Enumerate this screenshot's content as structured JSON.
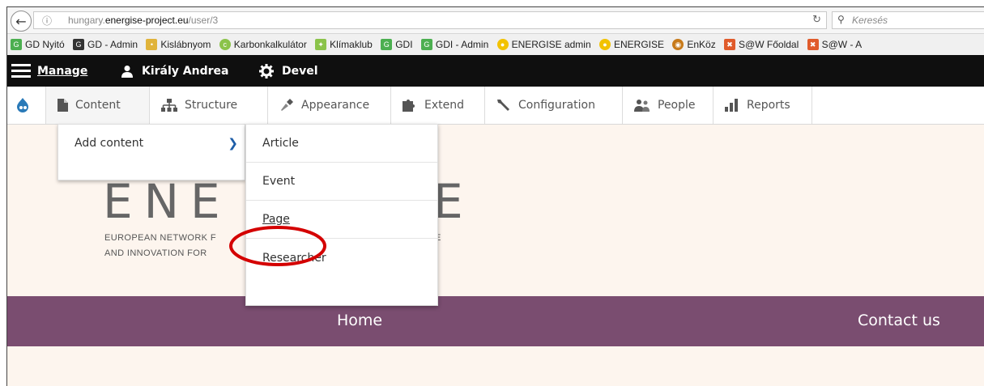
{
  "browser": {
    "url_prefix": "hungary.",
    "url_domain": "energise-project.eu",
    "url_path": "/user/3",
    "search_placeholder": "Keresés"
  },
  "bookmarks": [
    {
      "label": "GD Nyitó",
      "icon": "gd-icon",
      "color": "#4caf50"
    },
    {
      "label": "GD - Admin",
      "icon": "gd-admin-icon",
      "color": "#333333"
    },
    {
      "label": "Kislábnyom",
      "icon": "footprint-icon",
      "color": "#e0b33a"
    },
    {
      "label": "Karbonkalkulátor",
      "icon": "co2-icon",
      "color": "#8bc34a"
    },
    {
      "label": "Klímaklub",
      "icon": "leaf-icon",
      "color": "#8bc34a"
    },
    {
      "label": "GDI",
      "icon": "gdi-icon",
      "color": "#4caf50"
    },
    {
      "label": "GDI - Admin",
      "icon": "gdi-admin-icon",
      "color": "#4caf50"
    },
    {
      "label": "ENERGISE admin",
      "icon": "bulb-icon",
      "color": "#f2c200"
    },
    {
      "label": "ENERGISE",
      "icon": "bulb-icon",
      "color": "#f2c200"
    },
    {
      "label": "EnKöz",
      "icon": "enkoz-icon",
      "color": "#c77a1a"
    },
    {
      "label": "S@W Főoldal",
      "icon": "saw-icon",
      "color": "#e05b2b"
    },
    {
      "label": "S@W - A",
      "icon": "saw-icon",
      "color": "#e05b2b"
    }
  ],
  "toolbar": {
    "manage": "Manage",
    "user": "Király Andrea",
    "devel": "Devel"
  },
  "tray": {
    "content": "Content",
    "structure": "Structure",
    "appearance": "Appearance",
    "extend": "Extend",
    "configuration": "Configuration",
    "people": "People",
    "reports": "Reports"
  },
  "content_menu": {
    "add_content": "Add content"
  },
  "add_content_menu": [
    "Article",
    "Event",
    "Page",
    "Researcher"
  ],
  "site": {
    "logo_text": "ENE",
    "logo_tail": "E",
    "tagline1": "EUROPEAN NETWORK F",
    "tagline1_tail": "E",
    "tagline2": "AND INNOVATION FOR"
  },
  "nav": {
    "home": "Home",
    "contact": "Contact us"
  },
  "colors": {
    "toolbar_bg": "#0f0f0f",
    "nav_bg": "#7a4d70",
    "annotation": "#d40000"
  }
}
